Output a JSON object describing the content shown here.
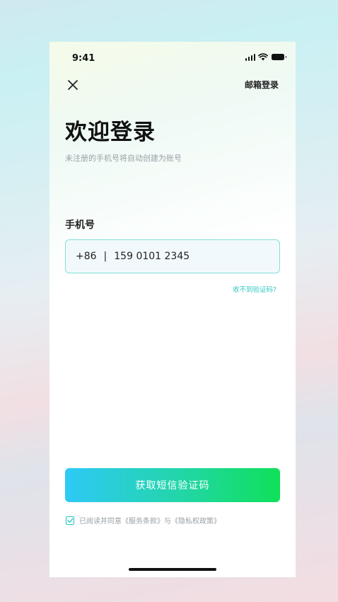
{
  "status_bar": {
    "time": "9:41"
  },
  "header": {
    "email_login": "邮箱登录"
  },
  "main": {
    "title": "欢迎登录",
    "subtitle": "未注册的手机号将自动创建为账号",
    "phone_label": "手机号",
    "phone_input": {
      "country_code": "+86",
      "separator": "|",
      "value": "159 0101 2345"
    },
    "no_code_link": "收不到验证码?",
    "get_code_button": "获取短信验证码",
    "agreement": "已阅读并同意《服务条款》与《隐私权政策》"
  },
  "colors": {
    "accent": "#22cbbd",
    "button_start": "#2ec9f7",
    "button_end": "#0fe05a"
  },
  "icons": [
    "close-icon",
    "signal-icon",
    "wifi-icon",
    "battery-icon",
    "check-icon"
  ]
}
